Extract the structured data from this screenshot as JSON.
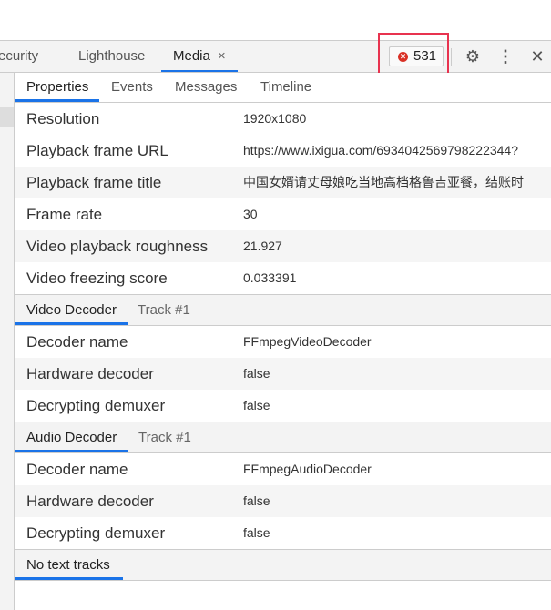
{
  "tabs": [
    {
      "label": "ecurity"
    },
    {
      "label": "Lighthouse"
    },
    {
      "label": "Media"
    }
  ],
  "close_tab": "×",
  "error_count": "531",
  "icons": {
    "error": "error-circle-icon",
    "settings": "gear-icon",
    "more": "kebab-icon",
    "close": "close-icon"
  },
  "subtabs": [
    "Properties",
    "Events",
    "Messages",
    "Timeline"
  ],
  "properties": [
    {
      "label": "Resolution",
      "value": "1920x1080"
    },
    {
      "label": "Playback frame URL",
      "value": "https://www.ixigua.com/6934042569798222344?"
    },
    {
      "label": "Playback frame title",
      "value": "中国女婿请丈母娘吃当地高档格鲁吉亚餐，结账时"
    },
    {
      "label": "Frame rate",
      "value": "30"
    },
    {
      "label": "Video playback roughness",
      "value": "21.927"
    },
    {
      "label": "Video freezing score",
      "value": "0.033391"
    }
  ],
  "video_decoder": {
    "tab": "Video Decoder",
    "track": "Track #1",
    "rows": [
      {
        "label": "Decoder name",
        "value": "FFmpegVideoDecoder"
      },
      {
        "label": "Hardware decoder",
        "value": "false"
      },
      {
        "label": "Decrypting demuxer",
        "value": "false"
      }
    ]
  },
  "audio_decoder": {
    "tab": "Audio Decoder",
    "track": "Track #1",
    "rows": [
      {
        "label": "Decoder name",
        "value": "FFmpegAudioDecoder"
      },
      {
        "label": "Hardware decoder",
        "value": "false"
      },
      {
        "label": "Decrypting demuxer",
        "value": "false"
      }
    ]
  },
  "text_tracks": "No text tracks",
  "colors": {
    "accent": "#1a73e8",
    "error": "#d93025",
    "highlight": "#e8334f"
  }
}
